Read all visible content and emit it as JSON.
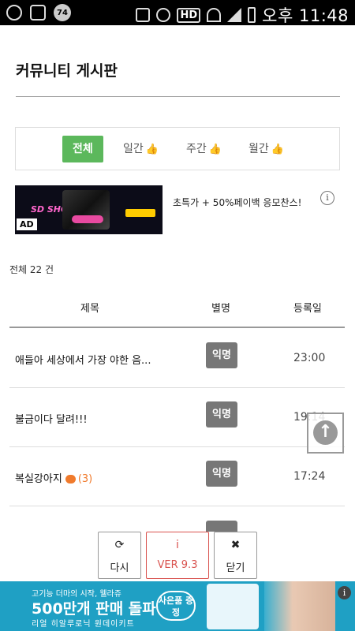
{
  "status_bar": {
    "notif_badge": "74",
    "hd_label": "HD",
    "time": "오후 11:48"
  },
  "page_title": "커뮤니티 게시판",
  "filters": [
    {
      "label": "전체",
      "active": true
    },
    {
      "label": "일간",
      "active": false
    },
    {
      "label": "주간",
      "active": false
    },
    {
      "label": "월간",
      "active": false
    }
  ],
  "ad": {
    "label": "AD",
    "text": "초특가 + 50%페이백 응모찬스!",
    "banner_logo": "SD SHOW"
  },
  "list": {
    "total": "전체 22 건",
    "headers": {
      "title": "제목",
      "nickname": "별명",
      "date": "등록일"
    },
    "rows": [
      {
        "title": "애들아 세상에서 가장 야한 음...",
        "nickname": "익명",
        "date": "23:00",
        "comments": ""
      },
      {
        "title": "불금이다 달려!!!",
        "nickname": "익명",
        "date": "19:14",
        "comments": ""
      },
      {
        "title": "복실강아지",
        "nickname": "익명",
        "date": "17:24",
        "comments": "(3)"
      }
    ]
  },
  "bottom_buttons": {
    "refresh": "다시",
    "version": "VER 9.3",
    "close": "닫기"
  },
  "bottom_ad": {
    "small": "고기능 더마의 시작, 웰라쥬",
    "big": "500만개 판매 돌파",
    "sub": "리얼 히알루로닉 원데이키트",
    "gift": "사은품 증정"
  },
  "colors": {
    "active_tab": "#5cb85c",
    "badge_gray": "#777777",
    "version_red": "#d9534f",
    "comment_orange": "#f07a2c",
    "ad_blue": "#1fa0c4"
  }
}
